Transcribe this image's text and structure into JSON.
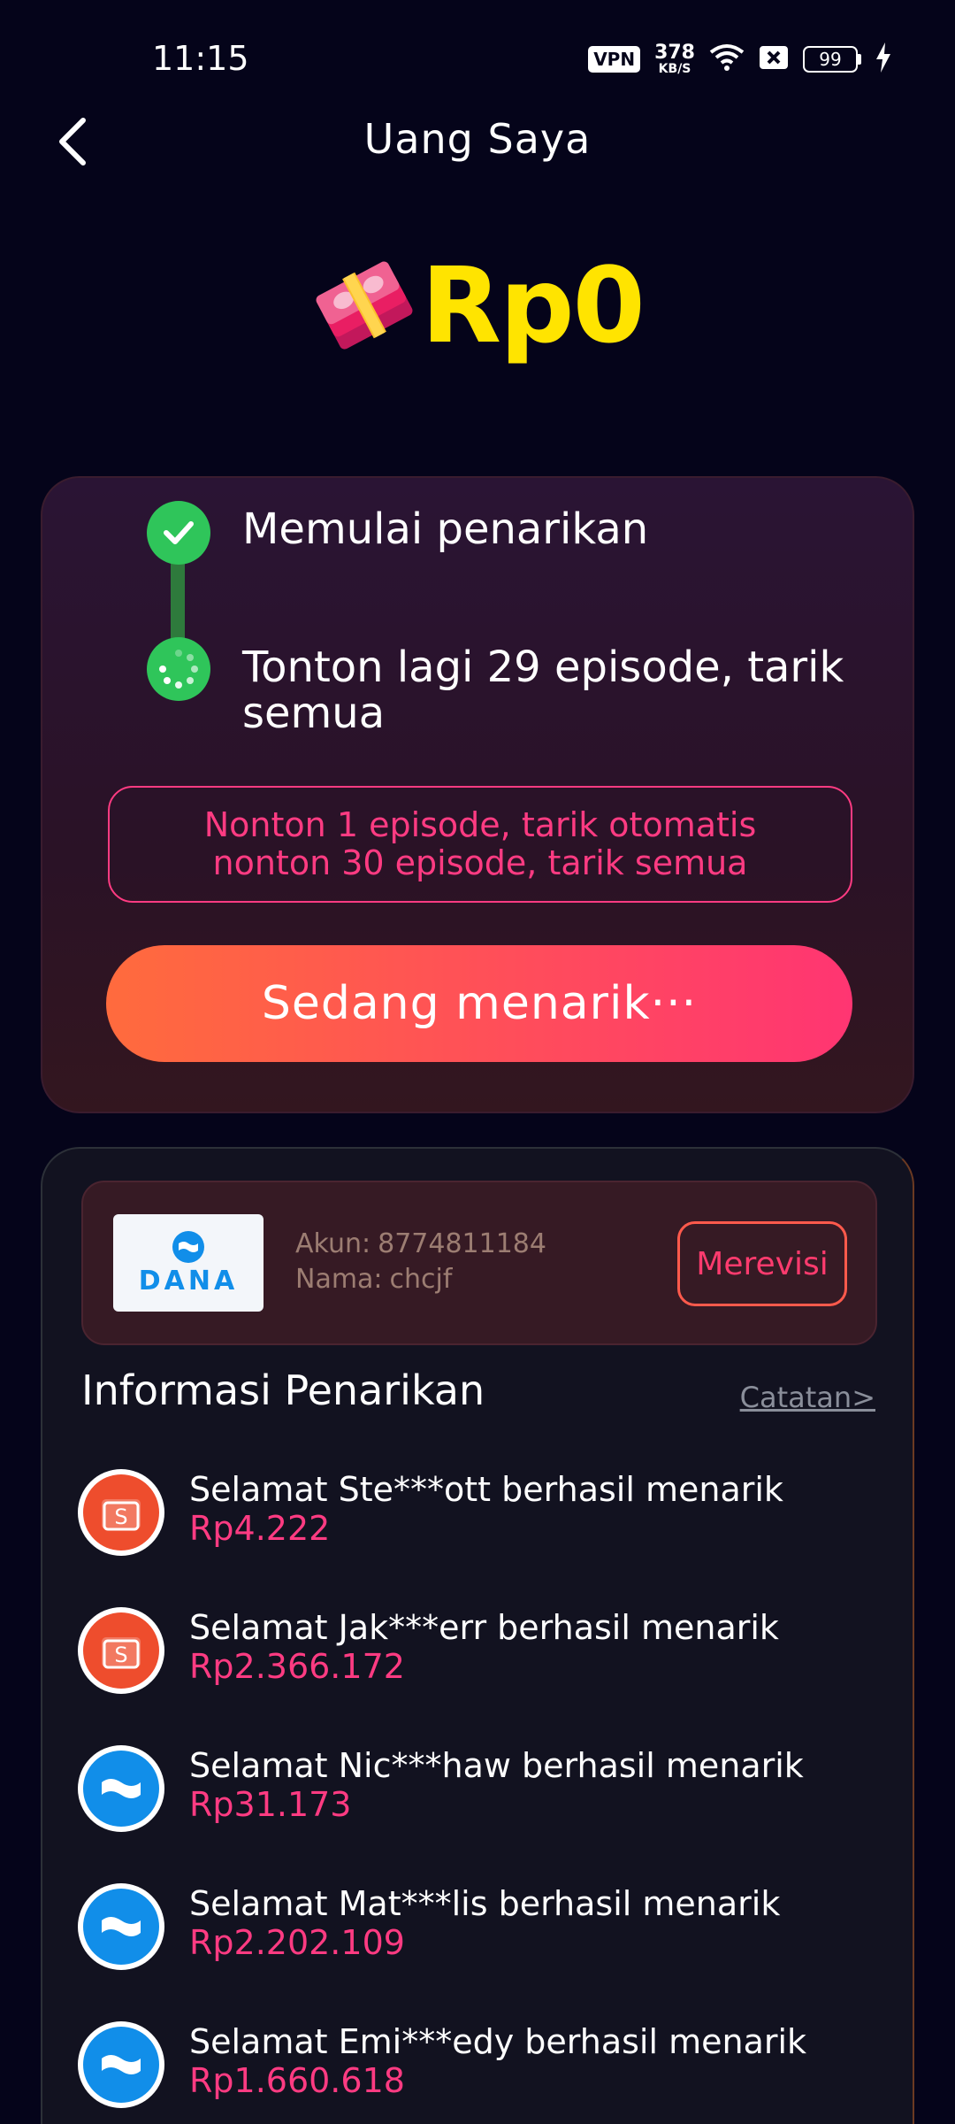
{
  "status_bar": {
    "time": "11:15",
    "vpn_label": "VPN",
    "net_speed_value": "378",
    "net_speed_unit": "KB/S",
    "battery_level": "99"
  },
  "header": {
    "title": "Uang Saya",
    "back_icon": "chevron-left-icon"
  },
  "balance": {
    "amount": "Rp0",
    "icon": "money-stack-icon",
    "color": "#ffe400"
  },
  "progress": {
    "steps": [
      {
        "label": "Memulai penarikan",
        "state": "done"
      },
      {
        "label": "Tonton lagi 29 episode, tarik semua",
        "state": "in-progress"
      }
    ],
    "rule_line_1": "Nonton 1 episode, tarik otomatis",
    "rule_line_2": "nonton 30 episode, tarik semua",
    "button_label": "Sedang menarik···"
  },
  "account": {
    "provider_logo_text": "DANA",
    "account_label": "Akun:",
    "account_value": "8774811184",
    "name_label": "Nama:",
    "name_value": "chcjf",
    "revise_label": "Merevisi"
  },
  "withdraw_info": {
    "title": "Informasi Penarikan",
    "records_link": "Catatan>",
    "items": [
      {
        "text": "Selamat Ste***ott berhasil menarik",
        "amount": "Rp4.222",
        "provider": "shopeepay"
      },
      {
        "text": "Selamat Jak***err berhasil menarik",
        "amount": "Rp2.366.172",
        "provider": "shopeepay"
      },
      {
        "text": "Selamat Nic***haw berhasil menarik",
        "amount": "Rp31.173",
        "provider": "dana"
      },
      {
        "text": "Selamat Mat***lis berhasil menarik",
        "amount": "Rp2.202.109",
        "provider": "dana"
      },
      {
        "text": "Selamat Emi***edy berhasil menarik",
        "amount": "Rp1.660.618",
        "provider": "dana"
      }
    ]
  },
  "colors": {
    "background": "#05041a",
    "accent_pink": "#ff3b82",
    "success_green": "#2fc55a",
    "button_gradient_start": "#ff6b3d",
    "button_gradient_end": "#ff3572"
  }
}
